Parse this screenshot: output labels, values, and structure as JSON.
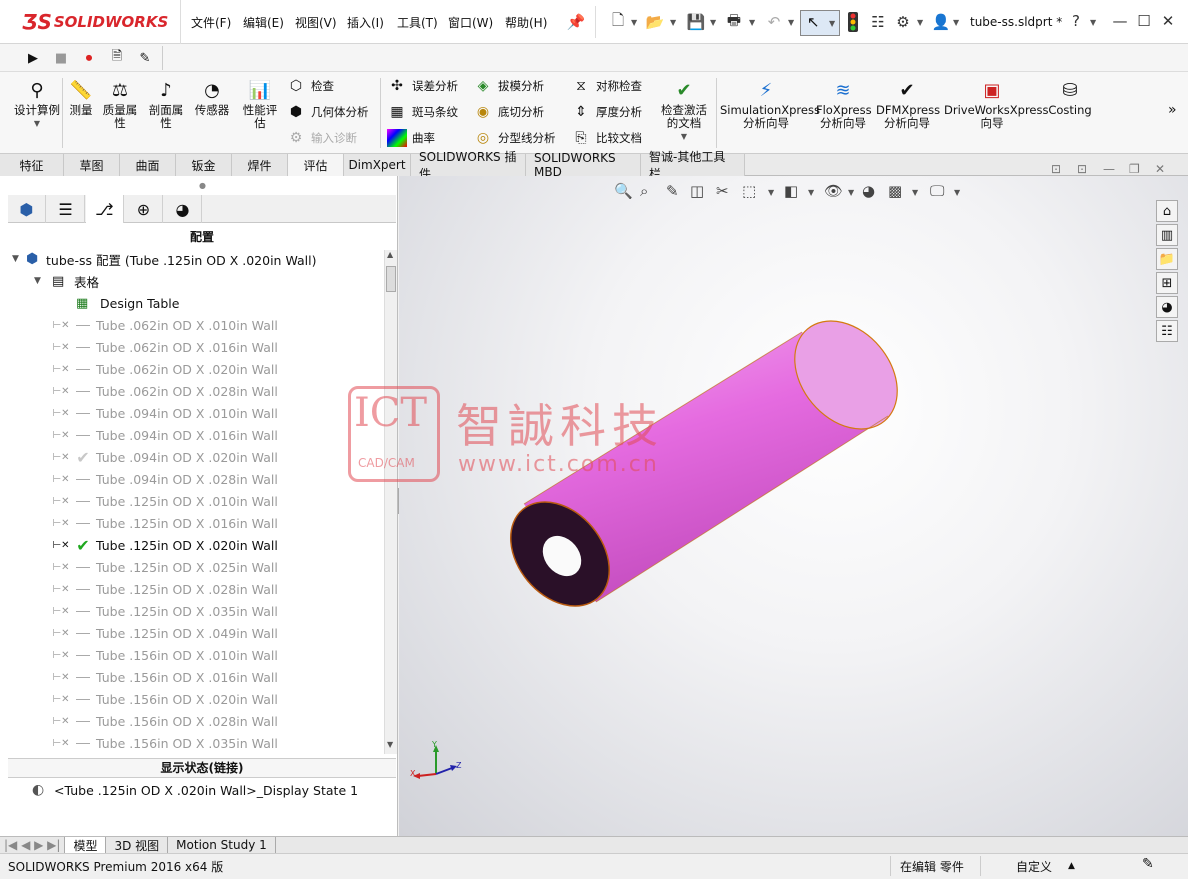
{
  "app": {
    "brand": "SOLIDWORKS",
    "filename": "tube-ss.sldprt *"
  },
  "menu": [
    {
      "label": "文件(F)"
    },
    {
      "label": "编辑(E)"
    },
    {
      "label": "视图(V)"
    },
    {
      "label": "插入(I)"
    },
    {
      "label": "工具(T)"
    },
    {
      "label": "窗口(W)"
    },
    {
      "label": "帮助(H)"
    }
  ],
  "ribbon": {
    "big": [
      {
        "label": "设计算例",
        "icon": "design-study-icon"
      },
      {
        "label": "测量",
        "icon": "measure-icon"
      },
      {
        "label": "质量属性",
        "icon": "mass-properties-icon"
      },
      {
        "label": "剖面属性",
        "icon": "section-properties-icon"
      },
      {
        "label": "传感器",
        "icon": "sensor-icon"
      },
      {
        "label": "性能评估",
        "icon": "performance-evaluation-icon"
      }
    ],
    "col1": [
      {
        "label": "检查"
      },
      {
        "label": "几何体分析"
      },
      {
        "label": "输入诊断"
      }
    ],
    "col2": [
      {
        "label": "误差分析"
      },
      {
        "label": "斑马条纹"
      },
      {
        "label": "曲率"
      }
    ],
    "col3": [
      {
        "label": "拔模分析"
      },
      {
        "label": "底切分析"
      },
      {
        "label": "分型线分析"
      }
    ],
    "col4": [
      {
        "label": "对称检查"
      },
      {
        "label": "厚度分析"
      },
      {
        "label": "比较文档"
      }
    ],
    "check_active": "检查激活的文档",
    "xpress": [
      {
        "label": "SimulationXpress分析向导"
      },
      {
        "label": "FloXpress分析向导"
      },
      {
        "label": "DFMXpress分析向导"
      },
      {
        "label": "DriveWorksXpress向导"
      },
      {
        "label": "Costing"
      }
    ]
  },
  "tabs": [
    {
      "label": "特征"
    },
    {
      "label": "草图"
    },
    {
      "label": "曲面"
    },
    {
      "label": "钣金"
    },
    {
      "label": "焊件"
    },
    {
      "label": "评估"
    },
    {
      "label": "DimXpert"
    },
    {
      "label": "SOLIDWORKS 插件"
    },
    {
      "label": "SOLIDWORKS MBD"
    },
    {
      "label": "智诚-其他工具栏"
    }
  ],
  "config": {
    "header": "配置",
    "root": "tube-ss 配置  (Tube .125in OD X .020in Wall)",
    "table_folder": "表格",
    "design_table": "Design Table",
    "items": [
      {
        "label": "Tube .062in OD X .010in Wall"
      },
      {
        "label": "Tube .062in OD X .016in Wall"
      },
      {
        "label": "Tube .062in OD X .020in Wall"
      },
      {
        "label": "Tube .062in OD X .028in Wall"
      },
      {
        "label": "Tube .094in OD X .010in Wall"
      },
      {
        "label": "Tube .094in OD X .016in Wall"
      },
      {
        "label": "Tube .094in OD X .020in Wall"
      },
      {
        "label": "Tube .094in OD X .028in Wall"
      },
      {
        "label": "Tube .125in OD X .010in Wall"
      },
      {
        "label": "Tube .125in OD X .016in Wall"
      },
      {
        "label": "Tube .125in OD X .020in Wall"
      },
      {
        "label": "Tube .125in OD X .025in Wall"
      },
      {
        "label": "Tube .125in OD X .028in Wall"
      },
      {
        "label": "Tube .125in OD X .035in Wall"
      },
      {
        "label": "Tube .125in OD X .049in Wall"
      },
      {
        "label": "Tube .156in OD X .010in Wall"
      },
      {
        "label": "Tube .156in OD X .016in Wall"
      },
      {
        "label": "Tube .156in OD X .020in Wall"
      },
      {
        "label": "Tube .156in OD X .028in Wall"
      },
      {
        "label": "Tube .156in OD X .035in Wall"
      }
    ],
    "active_index": 10,
    "last_active_index": 6
  },
  "display_state": {
    "header": "显示状态(链接)",
    "item": "<Tube .125in OD X .020in Wall>_Display State 1"
  },
  "bottom_tabs": [
    {
      "label": "模型"
    },
    {
      "label": "3D 视图"
    },
    {
      "label": "Motion Study 1"
    }
  ],
  "status": {
    "product": "SOLIDWORKS Premium 2016 x64 版",
    "editing": "在编辑 零件",
    "units": "自定义"
  },
  "watermark": {
    "logo": "ICT",
    "sub": "CAD/CAM",
    "name": "智誠科技",
    "url": "www.ict.com.cn"
  },
  "colors": {
    "tube": "#e56be0",
    "brand": "#d9262c"
  }
}
